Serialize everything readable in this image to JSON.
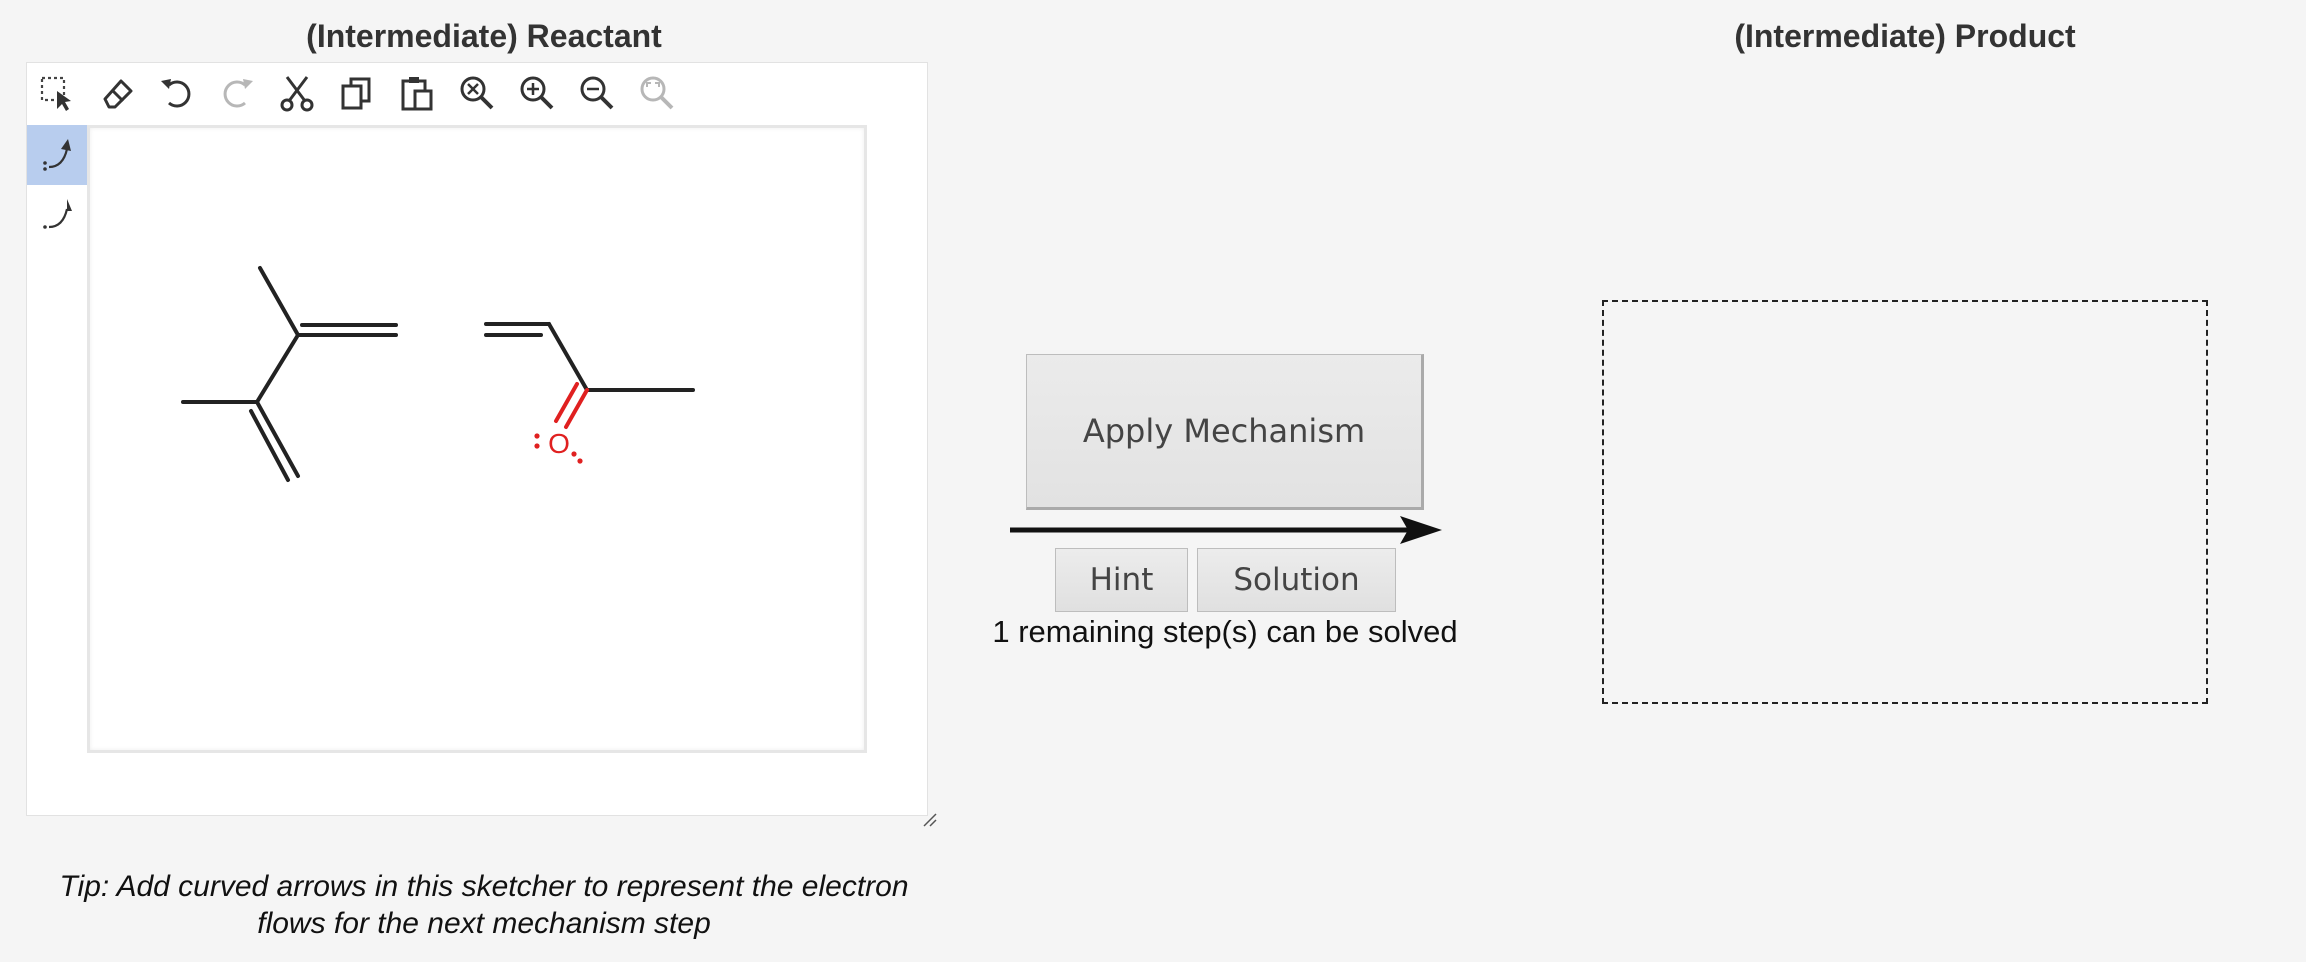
{
  "reactant_panel": {
    "title": "(Intermediate) Reactant",
    "toolbar": [
      {
        "icon": "select-rectangle-icon",
        "enabled": true
      },
      {
        "icon": "eraser-icon",
        "enabled": true
      },
      {
        "icon": "undo-icon",
        "enabled": true
      },
      {
        "icon": "redo-icon",
        "enabled": false
      },
      {
        "icon": "cut-icon",
        "enabled": true
      },
      {
        "icon": "copy-icon",
        "enabled": true
      },
      {
        "icon": "paste-icon",
        "enabled": true
      },
      {
        "icon": "zoom-reset-icon",
        "enabled": true
      },
      {
        "icon": "zoom-in-icon",
        "enabled": true
      },
      {
        "icon": "zoom-out-icon",
        "enabled": true
      },
      {
        "icon": "zoom-fit-icon",
        "enabled": false
      }
    ],
    "side_tools": [
      {
        "icon": "electron-pair-arrow-icon",
        "active": true
      },
      {
        "icon": "single-electron-arrow-icon",
        "active": false
      }
    ],
    "molecules": {
      "left": "2,3-dimethyl-1,3-butadiene",
      "right": "methyl vinyl ketone",
      "oxygen_label": "O",
      "oxygen_color": "#e02020"
    },
    "tip": "Tip: Add curved arrows in this sketcher to represent the electron flows for the next mechanism step"
  },
  "controls": {
    "apply_label": "Apply Mechanism",
    "hint_label": "Hint",
    "solution_label": "Solution",
    "status": "1 remaining step(s) can be solved"
  },
  "product_panel": {
    "title": "(Intermediate) Product"
  }
}
